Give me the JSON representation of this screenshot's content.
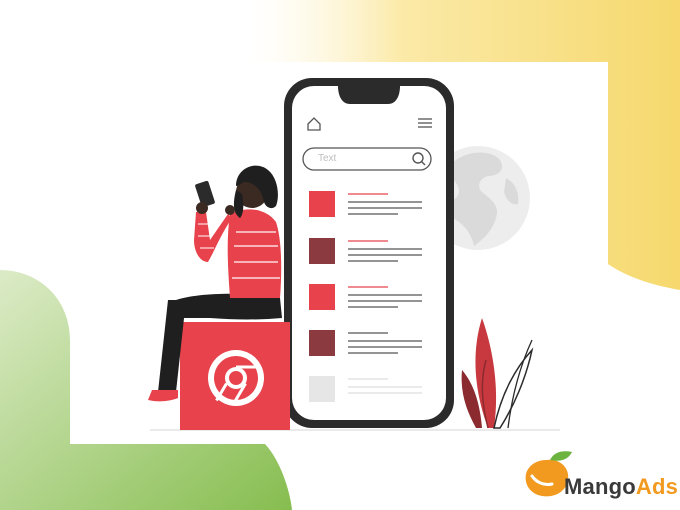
{
  "search": {
    "placeholder": "Text"
  },
  "brand": {
    "name_part1": "Mango",
    "name_part2": "Ads"
  },
  "colors": {
    "accent_red": "#e8434d",
    "dark_red": "#8b3a3f",
    "yellow": "#f6dc7a",
    "green": "#92c25c",
    "phone_frame": "#2b2b2b",
    "mango_orange": "#f29a1f"
  },
  "icons": [
    "home-icon",
    "hamburger-menu-icon",
    "search-icon",
    "browser-logo-icon",
    "globe-icon",
    "mango-logo-icon"
  ]
}
